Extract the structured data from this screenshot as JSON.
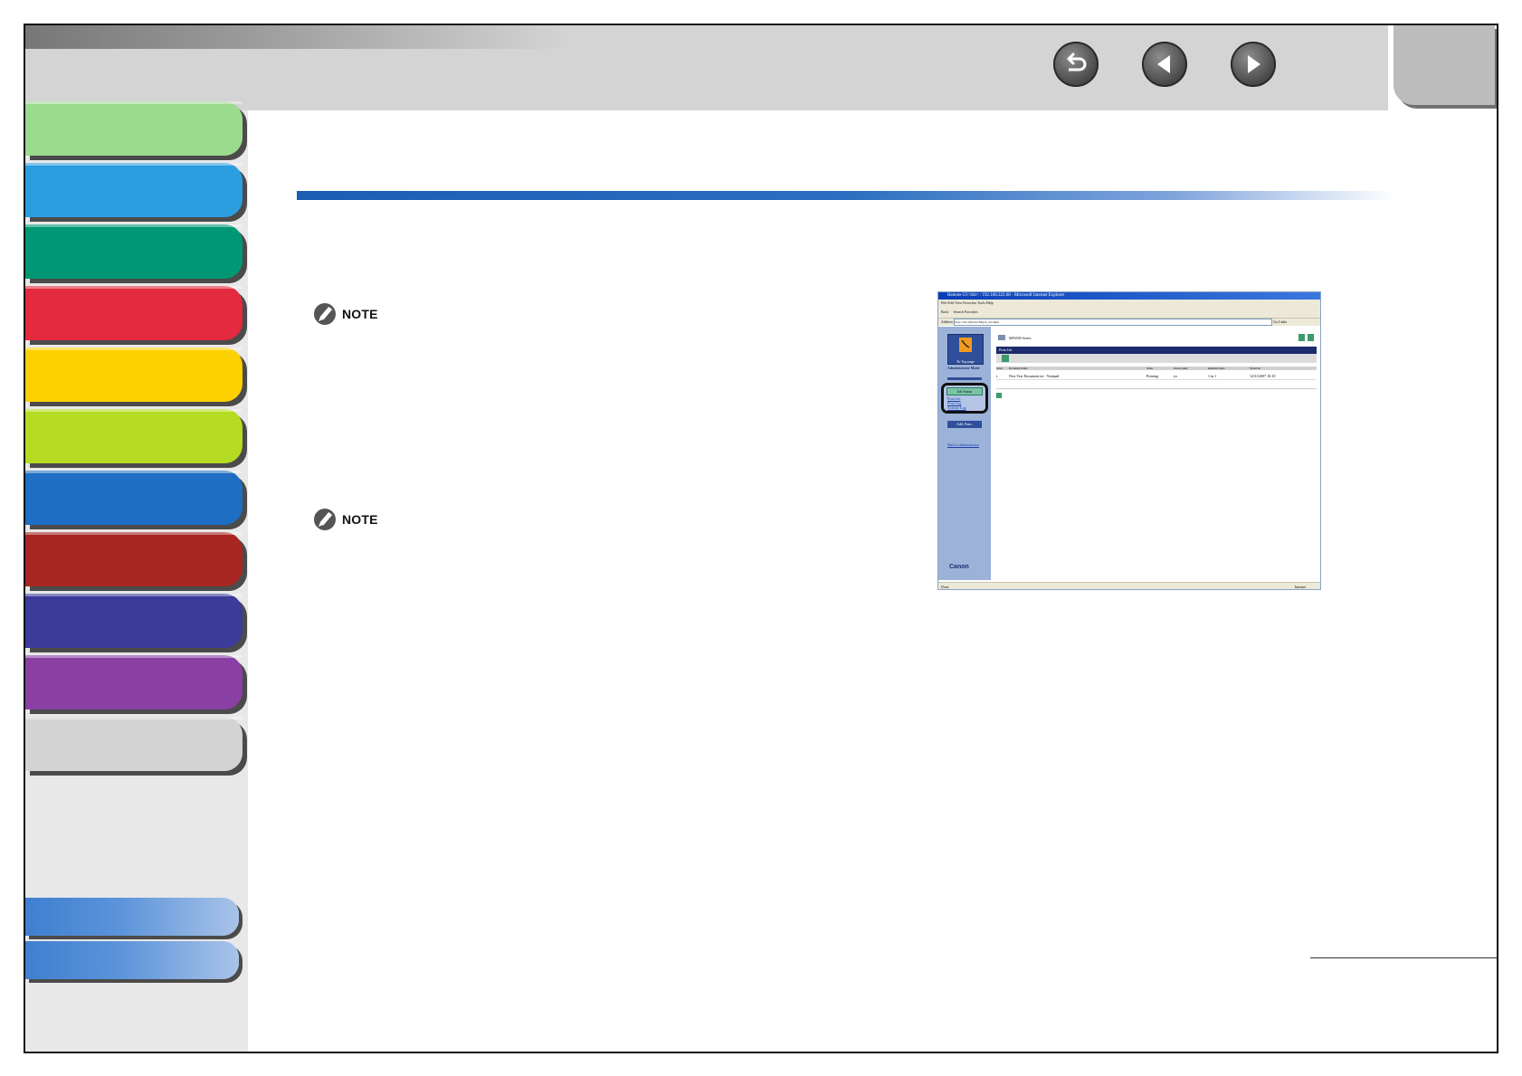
{
  "nav": {
    "back_icon": "return-arrow-icon",
    "prev_icon": "previous-page-icon",
    "next_icon": "next-page-icon"
  },
  "sidebar_tabs": [
    {
      "color": "#9bdb8e"
    },
    {
      "color": "#2b9ee0"
    },
    {
      "color": "#009874"
    },
    {
      "color": "#e32a3e"
    },
    {
      "color": "#fdd000"
    },
    {
      "color": "#b5dc22"
    },
    {
      "color": "#1e6ec3"
    },
    {
      "color": "#a82622"
    },
    {
      "color": "#3d3b9a"
    },
    {
      "color": "#8a3fa3"
    },
    {
      "color": "#d3d3d3"
    }
  ],
  "notes": [
    {
      "label": "NOTE"
    },
    {
      "label": "NOTE"
    }
  ],
  "screenshot": {
    "window_title": "Remote UI<Job> : 192.168.222.68 - Microsoft Internet Explorer",
    "menu": "File   Edit   View   Favorites   Tools   Help",
    "toolbar": "Back  ·  ·   Search   Favorites",
    "address_label": "Address",
    "address_url": "http://192.168.222.68/job_list.html",
    "go_label": "Go",
    "links_label": "Links",
    "top_page_label": "To Top page",
    "admin_mode_label": "Administrator Mode",
    "job_status_label": "Job Status",
    "job_links": [
      "Print Job",
      "Print Log",
      "Activity Log"
    ],
    "add_func_label": "Add. Func.",
    "mail_label": "Mail to Administrator",
    "brand": "Canon",
    "device_name": "MF6500 Series",
    "section_header": "Print Job",
    "table_headers": [
      "Select",
      "Document Name",
      "Status",
      "Owner name",
      "Remain/Copies",
      "Started At"
    ],
    "job_row": {
      "name": "New Text Document.txt - Notepad",
      "status": "Printing",
      "owner": "yo",
      "copies": "1 in 1",
      "started": "12/31/2007 10:10"
    },
    "status_bar_left": "Done",
    "status_bar_right": "Internet"
  }
}
